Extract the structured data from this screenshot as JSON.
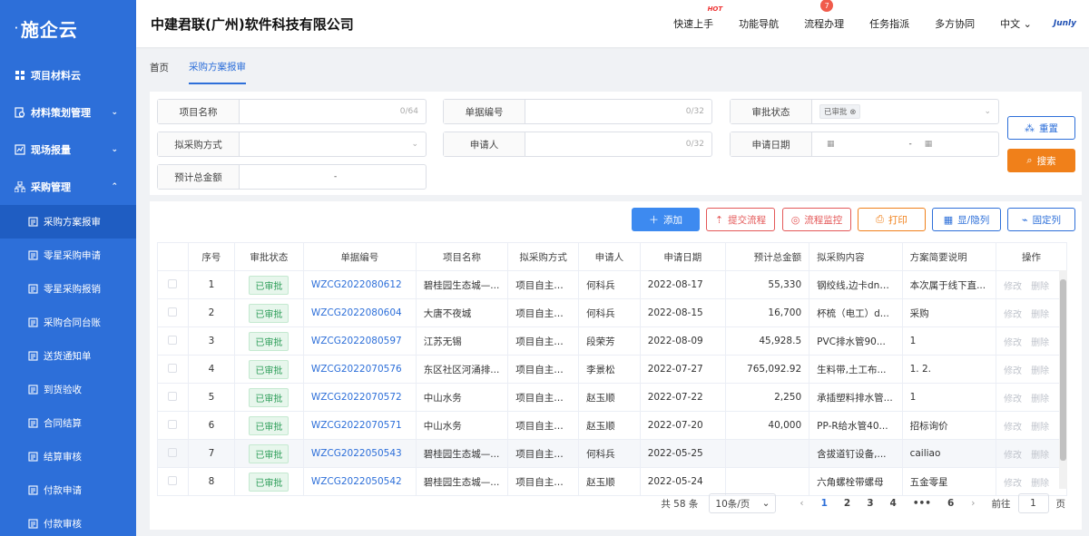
{
  "brand": {
    "name": "施企云",
    "dot": "·"
  },
  "sidebar": {
    "items": [
      {
        "label": "项目材料云",
        "chev": "",
        "icon": "grid-icon"
      },
      {
        "label": "材料策划管理",
        "chev": "⌄",
        "icon": "doc-search-icon"
      },
      {
        "label": "现场报量",
        "chev": "⌄",
        "icon": "report-icon"
      },
      {
        "label": "采购管理",
        "chev": "⌃",
        "icon": "org-icon"
      }
    ],
    "subitems": [
      {
        "label": "采购方案报审"
      },
      {
        "label": "零星采购申请"
      },
      {
        "label": "零星采购报销"
      },
      {
        "label": "采购合同台账"
      },
      {
        "label": "送货通知单"
      },
      {
        "label": "到货验收"
      },
      {
        "label": "合同结算"
      },
      {
        "label": "结算审核"
      },
      {
        "label": "付款申请"
      },
      {
        "label": "付款审核"
      }
    ]
  },
  "header": {
    "company": "中建君联(广州)软件科技有限公司",
    "nav": [
      "快速上手",
      "功能导航",
      "流程办理",
      "任务指派",
      "多方协同",
      "中文"
    ],
    "hot": "HOT",
    "badge": "7",
    "lang_chev": "⌄",
    "logo_text": "Junly"
  },
  "tabs": [
    "首页",
    "采购方案报审"
  ],
  "search": {
    "project_label": "项目名称",
    "project_count": "0/64",
    "doc_label": "单据编号",
    "doc_count": "0/32",
    "status_label": "审批状态",
    "status_tag": "已审批",
    "method_label": "拟采购方式",
    "applicant_label": "申请人",
    "applicant_count": "0/32",
    "date_label": "申请日期",
    "date_sep": "-",
    "amount_label": "预计总金额",
    "amount_sep": "-",
    "reset": "重置",
    "search": "搜索"
  },
  "toolbar": {
    "add": "添加",
    "submit": "提交流程",
    "monitor": "流程监控",
    "print": "打印",
    "cols": "显/隐列",
    "fix": "固定列"
  },
  "table": {
    "headers": [
      "序号",
      "审批状态",
      "单据编号",
      "项目名称",
      "拟采购方式",
      "申请人",
      "申请日期",
      "预计总金额",
      "拟采购内容",
      "方案简要说明",
      "操作"
    ],
    "edit": "修改",
    "del": "删除",
    "rows": [
      {
        "no": "1",
        "status": "已审批",
        "code": "WZCG2022080612",
        "project": "碧桂园生态城—...",
        "method": "项目自主招标",
        "applicant": "何科兵",
        "date": "2022-08-17",
        "amount": "55,330",
        "content": "钢绞线,边卡dn2...",
        "desc": "本次属于线下直..."
      },
      {
        "no": "2",
        "status": "已审批",
        "code": "WZCG2022080604",
        "project": "大唐不夜城",
        "method": "项目自主招标",
        "applicant": "何科兵",
        "date": "2022-08-15",
        "amount": "16,700",
        "content": "杯梳（电工）d...",
        "desc": "采购"
      },
      {
        "no": "3",
        "status": "已审批",
        "code": "WZCG2022080597",
        "project": "江苏无锡",
        "method": "项目自主询价",
        "applicant": "段荣芳",
        "date": "2022-08-09",
        "amount": "45,928.5",
        "content": "PVC排水管90...",
        "desc": "1"
      },
      {
        "no": "4",
        "status": "已审批",
        "code": "WZCG2022070576",
        "project": "东区社区河涌排...",
        "method": "项目自主招标",
        "applicant": "李景松",
        "date": "2022-07-27",
        "amount": "765,092.92",
        "content": "生料带,土工布...",
        "desc": "1. 2."
      },
      {
        "no": "5",
        "status": "已审批",
        "code": "WZCG2022070572",
        "project": "中山水务",
        "method": "项目自主询价",
        "applicant": "赵玉顺",
        "date": "2022-07-22",
        "amount": "2,250",
        "content": "承插塑料排水管...",
        "desc": "1"
      },
      {
        "no": "6",
        "status": "已审批",
        "code": "WZCG2022070571",
        "project": "中山水务",
        "method": "项目自主询价",
        "applicant": "赵玉顺",
        "date": "2022-07-20",
        "amount": "40,000",
        "content": "PP-R给水管40...",
        "desc": "招标询价"
      },
      {
        "no": "7",
        "status": "已审批",
        "code": "WZCG2022050543",
        "project": "碧桂园生态城—...",
        "method": "项目自主招标",
        "applicant": "何科兵",
        "date": "2022-05-25",
        "amount": "",
        "content": "含拔道钉设备,...",
        "desc": "cailiao"
      },
      {
        "no": "8",
        "status": "已审批",
        "code": "WZCG2022050542",
        "project": "碧桂园生态城—...",
        "method": "项目自主询价",
        "applicant": "赵玉顺",
        "date": "2022-05-24",
        "amount": "",
        "content": "六角螺栓带螺母",
        "desc": "五金零星"
      }
    ]
  },
  "pager": {
    "total": "共 58 条",
    "size": "10条/页",
    "pages": [
      "1",
      "2",
      "3",
      "4",
      "•••",
      "6"
    ],
    "prev": "‹",
    "next": "›",
    "goto": "前往",
    "page_input": "1",
    "page_unit": "页"
  },
  "colors": {
    "primary": "#2d6fd9",
    "orange": "#f0801a",
    "green": "#2f9e5a",
    "red": "#e45858"
  }
}
